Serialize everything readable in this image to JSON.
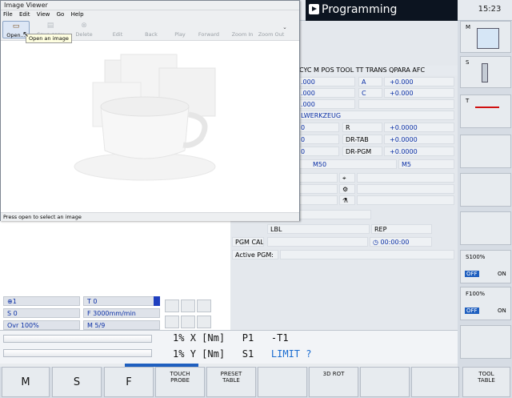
{
  "topbar": {
    "mode_title": "Programming",
    "clock": "15:23"
  },
  "status": {
    "header": "CYC M POS TOOL TT TRANS QPARA AFC",
    "rows": [
      {
        "a": ".000",
        "b": "A",
        "c": "+0.000"
      },
      {
        "a": ".000",
        "b": "C",
        "c": "+0.000"
      },
      {
        "a": ".000"
      }
    ],
    "tool_name": "LWERKZEUG",
    "r_label": "R",
    "r_value": "+0.0000",
    "drtab_label": "DR-TAB",
    "drtab_value": "+0.0000",
    "drpgm_label": "DR-PGM",
    "drpgm_value": "+0.0000",
    "zero1": "0",
    "zero2": "0",
    "zero3": "0",
    "m50": "M50",
    "m5": "M5",
    "lbl_label": "LBL",
    "rep_label": "REP",
    "pgmcall_label": "PGM CALL",
    "time": "00:00:00",
    "active_pgm_label": "Active PGM:"
  },
  "left_lower": {
    "feed_override": "1",
    "tool": "T 0",
    "spindle": "S 0",
    "feed": "F 3000mm/min",
    "override": "Ovr 100%",
    "m_funcs": "M 5/9"
  },
  "position": {
    "line1": {
      "percent": "1%",
      "axis": "X",
      "unit": "[Nm]",
      "p": "P1",
      "value": "-T1"
    },
    "line2": {
      "percent": "1%",
      "axis": "Y",
      "unit": "[Nm]",
      "s": "S1",
      "limit": "LIMIT ?"
    }
  },
  "right_softkeys": [
    {
      "label": "M"
    },
    {
      "label": "S"
    },
    {
      "label": "T"
    },
    {
      "label": ""
    },
    {
      "label": ""
    },
    {
      "label": ""
    },
    {
      "label": "S100%",
      "off": "OFF",
      "on": "ON"
    },
    {
      "label": "F100%",
      "off": "OFF",
      "on": "ON"
    },
    {
      "label": ""
    }
  ],
  "bottom_softkeys": [
    {
      "label": "M"
    },
    {
      "label": "S"
    },
    {
      "label": "F"
    },
    {
      "label": "TOUCH PROBE"
    },
    {
      "label": "PRESET TABLE"
    },
    {
      "label": ""
    },
    {
      "label": "3D ROT"
    },
    {
      "label": ""
    },
    {
      "label": ""
    },
    {
      "label": "TOOL TABLE"
    }
  ],
  "viewer": {
    "title": "Image Viewer",
    "menu": [
      "File",
      "Edit",
      "View",
      "Go",
      "Help"
    ],
    "toolbar": [
      "Open...",
      "Save copy",
      "Delete",
      "Edit",
      "Back",
      "Play",
      "Forward",
      "Zoom In",
      "Zoom Out"
    ],
    "tooltip": "Open an image",
    "status": "Press open to select an image"
  },
  "colors": {
    "accent": "#1f5fbf",
    "value_blue": "#0a2fa5",
    "mode_bg": "#0c1420"
  }
}
